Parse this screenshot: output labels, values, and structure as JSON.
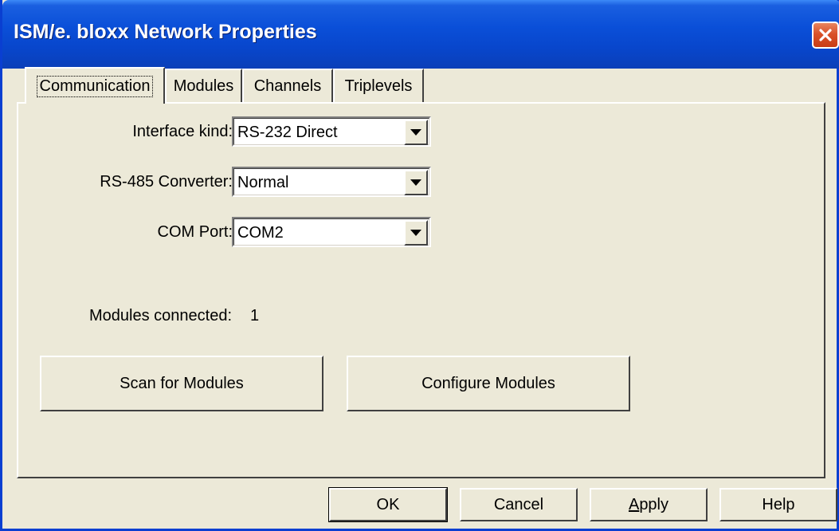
{
  "window": {
    "title": "ISM/e. bloxx Network Properties"
  },
  "tabs": [
    {
      "label": "Communication",
      "active": true
    },
    {
      "label": "Modules",
      "active": false
    },
    {
      "label": "Channels",
      "active": false
    },
    {
      "label": "Triplevels",
      "active": false
    }
  ],
  "communication": {
    "interface_kind": {
      "label": "Interface kind:",
      "value": "RS-232 Direct"
    },
    "rs485_converter": {
      "label": "RS-485 Converter:",
      "value": "Normal"
    },
    "com_port": {
      "label": "COM Port:",
      "value": "COM2"
    },
    "modules_connected_label": "Modules connected:",
    "modules_connected_value": "1",
    "scan_button": "Scan for Modules",
    "configure_button": "Configure Modules"
  },
  "footer": {
    "ok": "OK",
    "cancel": "Cancel",
    "apply_mnemonic": "A",
    "apply_rest": "pply",
    "help": "Help"
  },
  "icons": {
    "close": "close-icon",
    "dropdown": "chevron-down-icon"
  },
  "colors": {
    "titlebar": "#0a4fd8",
    "close_button": "#d9522a",
    "face": "#ece9d8"
  }
}
